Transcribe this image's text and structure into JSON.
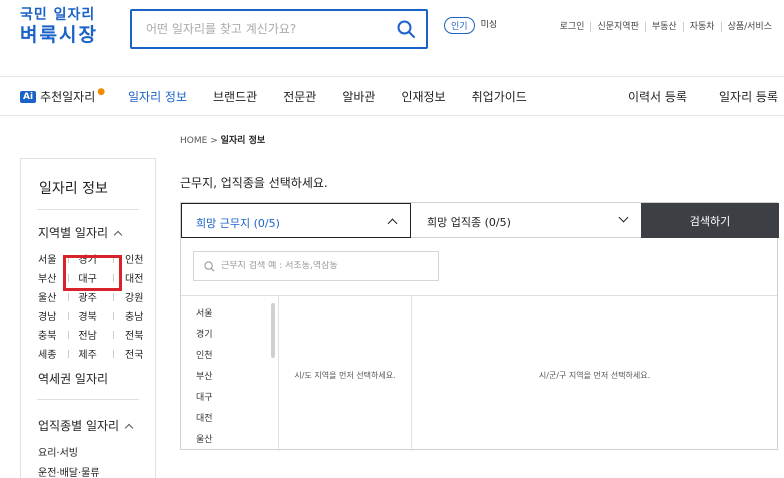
{
  "header": {
    "logo_line1": "국민 일자리",
    "logo_line2": "벼룩시장",
    "search_placeholder": "어떤 일자리를 찾고 계신가요?",
    "popular_badge": "인기",
    "popular_text": "미싱",
    "util_links": [
      "로그인",
      "신문지역판",
      "부동산",
      "자동차",
      "상품/서비스"
    ]
  },
  "gnb": {
    "ai_badge": "Ai",
    "ai_label": "추천일자리",
    "ai_dot": "●",
    "menu": [
      "일자리 정보",
      "브랜드관",
      "전문관",
      "알바관",
      "인재정보",
      "취업가이드"
    ],
    "right": [
      "이력서 등록",
      "일자리 등록"
    ]
  },
  "breadcrumb": {
    "home": "HOME",
    "sep": ">",
    "current": "일자리 정보"
  },
  "sidebar": {
    "title": "일자리 정보",
    "region_title": "지역별 일자리",
    "regions": [
      [
        "서울",
        "경기",
        "인천"
      ],
      [
        "부산",
        "대구",
        "대전"
      ],
      [
        "울산",
        "광주",
        "강원"
      ],
      [
        "경남",
        "경북",
        "충남"
      ],
      [
        "충북",
        "전남",
        "전북"
      ],
      [
        "세종",
        "제주",
        "전국"
      ]
    ],
    "station_title": "역세권 일자리",
    "job_title": "업직종별 일자리",
    "job_items": [
      "요리·서빙",
      "운전·배달·물류"
    ]
  },
  "main": {
    "title": "근무지, 업직종을 선택하세요.",
    "select_area": "희망 근무지 (0/5)",
    "select_job": "희망 업직종 (0/5)",
    "search_button": "검색하기",
    "area_search_placeholder": "근무지 검색 예 : 서초동,역삼동",
    "cities": [
      "서울",
      "경기",
      "인천",
      "부산",
      "대구",
      "대전",
      "울산"
    ],
    "col2_message": "시/도 지역을 먼저 선택하세요.",
    "col3_message": "시/군/구 지역을 먼저 선택하세요."
  },
  "colors": {
    "accent": "#1a62c7",
    "highlight": "#d9232b",
    "search_button_bg": "#3c3f44"
  }
}
